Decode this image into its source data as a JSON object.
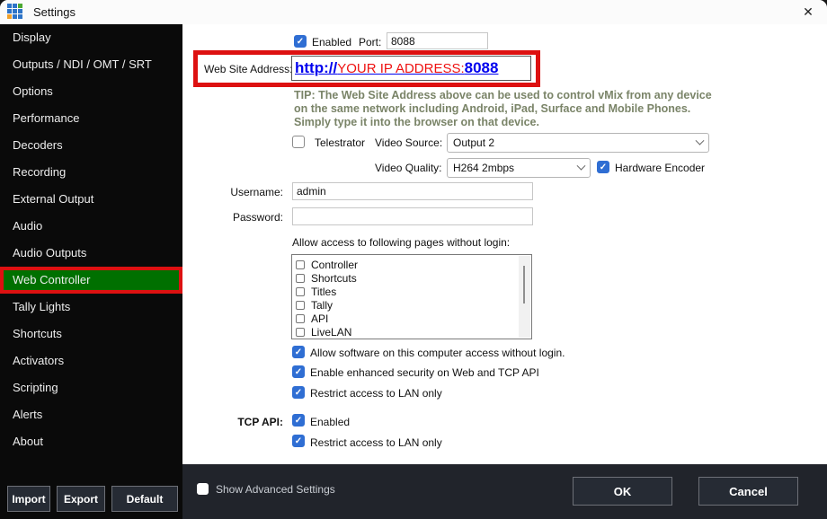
{
  "window": {
    "title": "Settings",
    "close_icon": "✕"
  },
  "sidebar": {
    "items": [
      "Display",
      "Outputs / NDI / OMT / SRT",
      "Options",
      "Performance",
      "Decoders",
      "Recording",
      "External Output",
      "Audio",
      "Audio Outputs",
      "Web Controller",
      "Tally Lights",
      "Shortcuts",
      "Activators",
      "Scripting",
      "Alerts",
      "About"
    ],
    "selected_item": "Web Controller",
    "import_label": "Import",
    "export_label": "Export",
    "default_label": "Default"
  },
  "content": {
    "enabled_label": "Enabled",
    "port_label": "Port:",
    "port_value": "8088",
    "website_label": "Web Site Address:",
    "website_scheme": "http://",
    "website_host": "YOUR IP ADDRESS",
    "website_colon": ":",
    "website_port": "8088",
    "tip_line1": "TIP: The Web Site Address above can be used to control vMix from any device",
    "tip_line2": "on the same network including Android, iPad, Surface and Mobile Phones.",
    "tip_line3": "Simply type it into the browser on that device.",
    "telestrator_label": "Telestrator",
    "video_source_label": "Video Source:",
    "video_source_value": "Output 2",
    "video_quality_label": "Video Quality:",
    "video_quality_value": "H264 2mbps",
    "hardware_encoder_label": "Hardware Encoder",
    "username_label": "Username:",
    "username_value": "admin",
    "password_label": "Password:",
    "password_value": "",
    "allow_pages_label": "Allow access to following pages without login:",
    "page_options": [
      "Controller",
      "Shortcuts",
      "Titles",
      "Tally",
      "API",
      "LiveLAN"
    ],
    "security_options": [
      "Allow software on this computer access without login.",
      "Enable enhanced security on Web and TCP API",
      "Restrict access to LAN only"
    ],
    "tcp_api_label": "TCP API:",
    "tcp_enabled_label": "Enabled",
    "tcp_restrict_label": "Restrict access to LAN only"
  },
  "footer": {
    "show_advanced_label": "Show Advanced Settings",
    "ok_label": "OK",
    "cancel_label": "Cancel"
  },
  "colors": {
    "accent_blue": "#2f6ed3",
    "annotation_red": "#dd1111",
    "selected_green": "#007000",
    "url_blue": "#0000ee",
    "url_red": "#ee1111",
    "tip_text": "#7a8468"
  }
}
